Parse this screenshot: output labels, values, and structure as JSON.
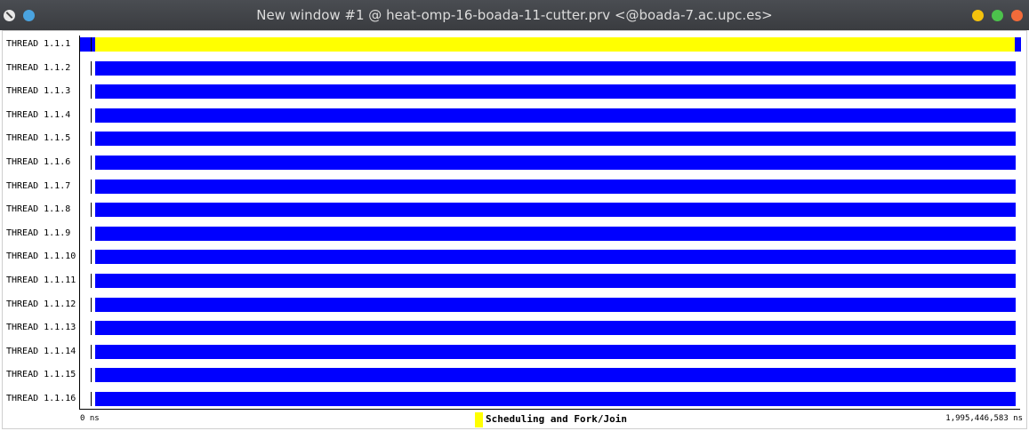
{
  "window": {
    "title": "New window #1 @ heat-omp-16-boada-11-cutter.prv <@boada-7.ac.upc.es>"
  },
  "threads": [
    {
      "label": "THREAD 1.1.1",
      "state": "Scheduling and Fork/Join"
    },
    {
      "label": "THREAD 1.1.2",
      "state": "Running"
    },
    {
      "label": "THREAD 1.1.3",
      "state": "Running"
    },
    {
      "label": "THREAD 1.1.4",
      "state": "Running"
    },
    {
      "label": "THREAD 1.1.5",
      "state": "Running"
    },
    {
      "label": "THREAD 1.1.6",
      "state": "Running"
    },
    {
      "label": "THREAD 1.1.7",
      "state": "Running"
    },
    {
      "label": "THREAD 1.1.8",
      "state": "Running"
    },
    {
      "label": "THREAD 1.1.9",
      "state": "Running"
    },
    {
      "label": "THREAD 1.1.10",
      "state": "Running"
    },
    {
      "label": "THREAD 1.1.11",
      "state": "Running"
    },
    {
      "label": "THREAD 1.1.12",
      "state": "Running"
    },
    {
      "label": "THREAD 1.1.13",
      "state": "Running"
    },
    {
      "label": "THREAD 1.1.14",
      "state": "Running"
    },
    {
      "label": "THREAD 1.1.15",
      "state": "Running"
    },
    {
      "label": "THREAD 1.1.16",
      "state": "Running"
    }
  ],
  "axis": {
    "start": "0 ns",
    "end": "1,995,446,583 ns"
  },
  "legend": {
    "label": "Scheduling and Fork/Join",
    "color": "#ffff00"
  },
  "colors": {
    "running": "#0000ff",
    "fork_join": "#ffff00"
  },
  "icons": [
    "window-menu-icon",
    "pin-icon",
    "minimize-icon",
    "maximize-icon",
    "close-icon"
  ]
}
